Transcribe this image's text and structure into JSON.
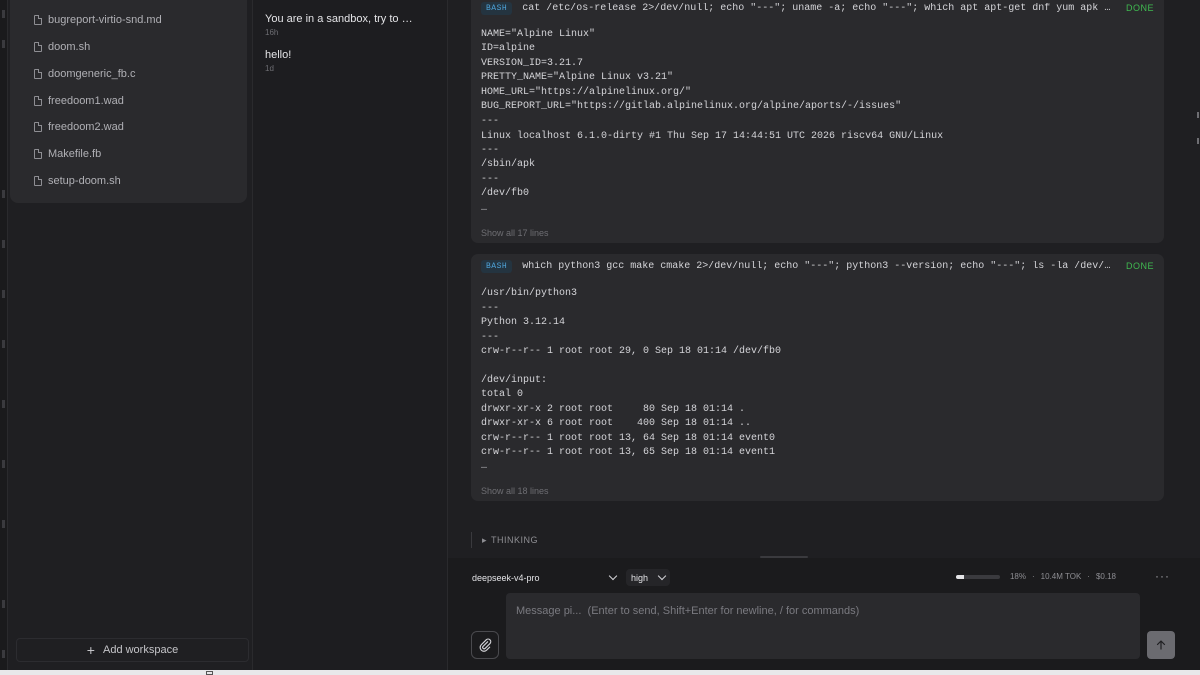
{
  "sidebar": {
    "files": [
      {
        "name": "bugreport-virtio-snd.md"
      },
      {
        "name": "doom.sh"
      },
      {
        "name": "doomgeneric_fb.c"
      },
      {
        "name": "freedoom1.wad"
      },
      {
        "name": "freedoom2.wad"
      },
      {
        "name": "Makefile.fb"
      },
      {
        "name": "setup-doom.sh"
      }
    ],
    "add_workspace_label": "Add workspace"
  },
  "sessions": [
    {
      "title": "You are in a sandbox, try to …",
      "time": "16h"
    },
    {
      "title": "hello!",
      "time": "1d"
    }
  ],
  "tool_calls": [
    {
      "badge": "BASH",
      "command": "cat /etc/os-release 2>/dev/null; echo \"---\"; uname -a; echo \"---\"; which apt apt-get dnf yum apk pacman…",
      "status": "DONE",
      "output_blocks": [
        "NAME=\"Alpine Linux\"\nID=alpine\nVERSION_ID=3.21.7\nPRETTY_NAME=\"Alpine Linux v3.21\"\nHOME_URL=\"https://alpinelinux.org/\"\nBUG_REPORT_URL=\"https://gitlab.alpinelinux.org/alpine/aports/-/issues\"",
        "---",
        "Linux localhost 6.1.0-dirty #1 Thu Sep 17 14:44:51 UTC 2026 riscv64 GNU/Linux",
        "---",
        "/sbin/apk",
        "---",
        "/dev/fb0",
        "…"
      ],
      "show_all": "Show all 17 lines"
    },
    {
      "badge": "BASH",
      "command": "which python3 gcc make cmake 2>/dev/null; echo \"---\"; python3 --version; echo \"---\"; ls -la /dev/fb0 /d…",
      "status": "DONE",
      "output_blocks": [
        "/usr/bin/python3",
        "---",
        "Python 3.12.14",
        "---",
        "crw-r--r-- 1 root root 29, 0 Sep 18 01:14 /dev/fb0",
        "/dev/input:\ntotal 0\ndrwxr-xr-x 2 root root     80 Sep 18 01:14 .\ndrwxr-xr-x 6 root root    400 Sep 18 01:14 ..\ncrw-r--r-- 1 root root 13, 64 Sep 18 01:14 event0\ncrw-r--r-- 1 root root 13, 65 Sep 18 01:14 event1",
        "…"
      ],
      "show_all": "Show all 18 lines"
    }
  ],
  "thinking_label": "THINKING",
  "composer": {
    "model": "deepseek-v4-pro",
    "effort": "high",
    "context_fraction": 0.18,
    "context_percent": "18%",
    "tokens": "10.4M TOK",
    "cost": "$0.18",
    "more_label": "···",
    "placeholder": "Message pi...  (Enter to send, Shift+Enter for newline, / for commands)"
  },
  "colors": {
    "background": "#1f1f22",
    "card": "#2a2a2d",
    "badge_text": "#4ea3d8",
    "done_status": "#3fb950",
    "send_button": "#6b6b70"
  },
  "icons": [
    "file-icon",
    "plus-icon",
    "chevron-down-icon",
    "paperclip-icon",
    "arrow-up-icon",
    "more-icon",
    "caret-right-icon"
  ]
}
